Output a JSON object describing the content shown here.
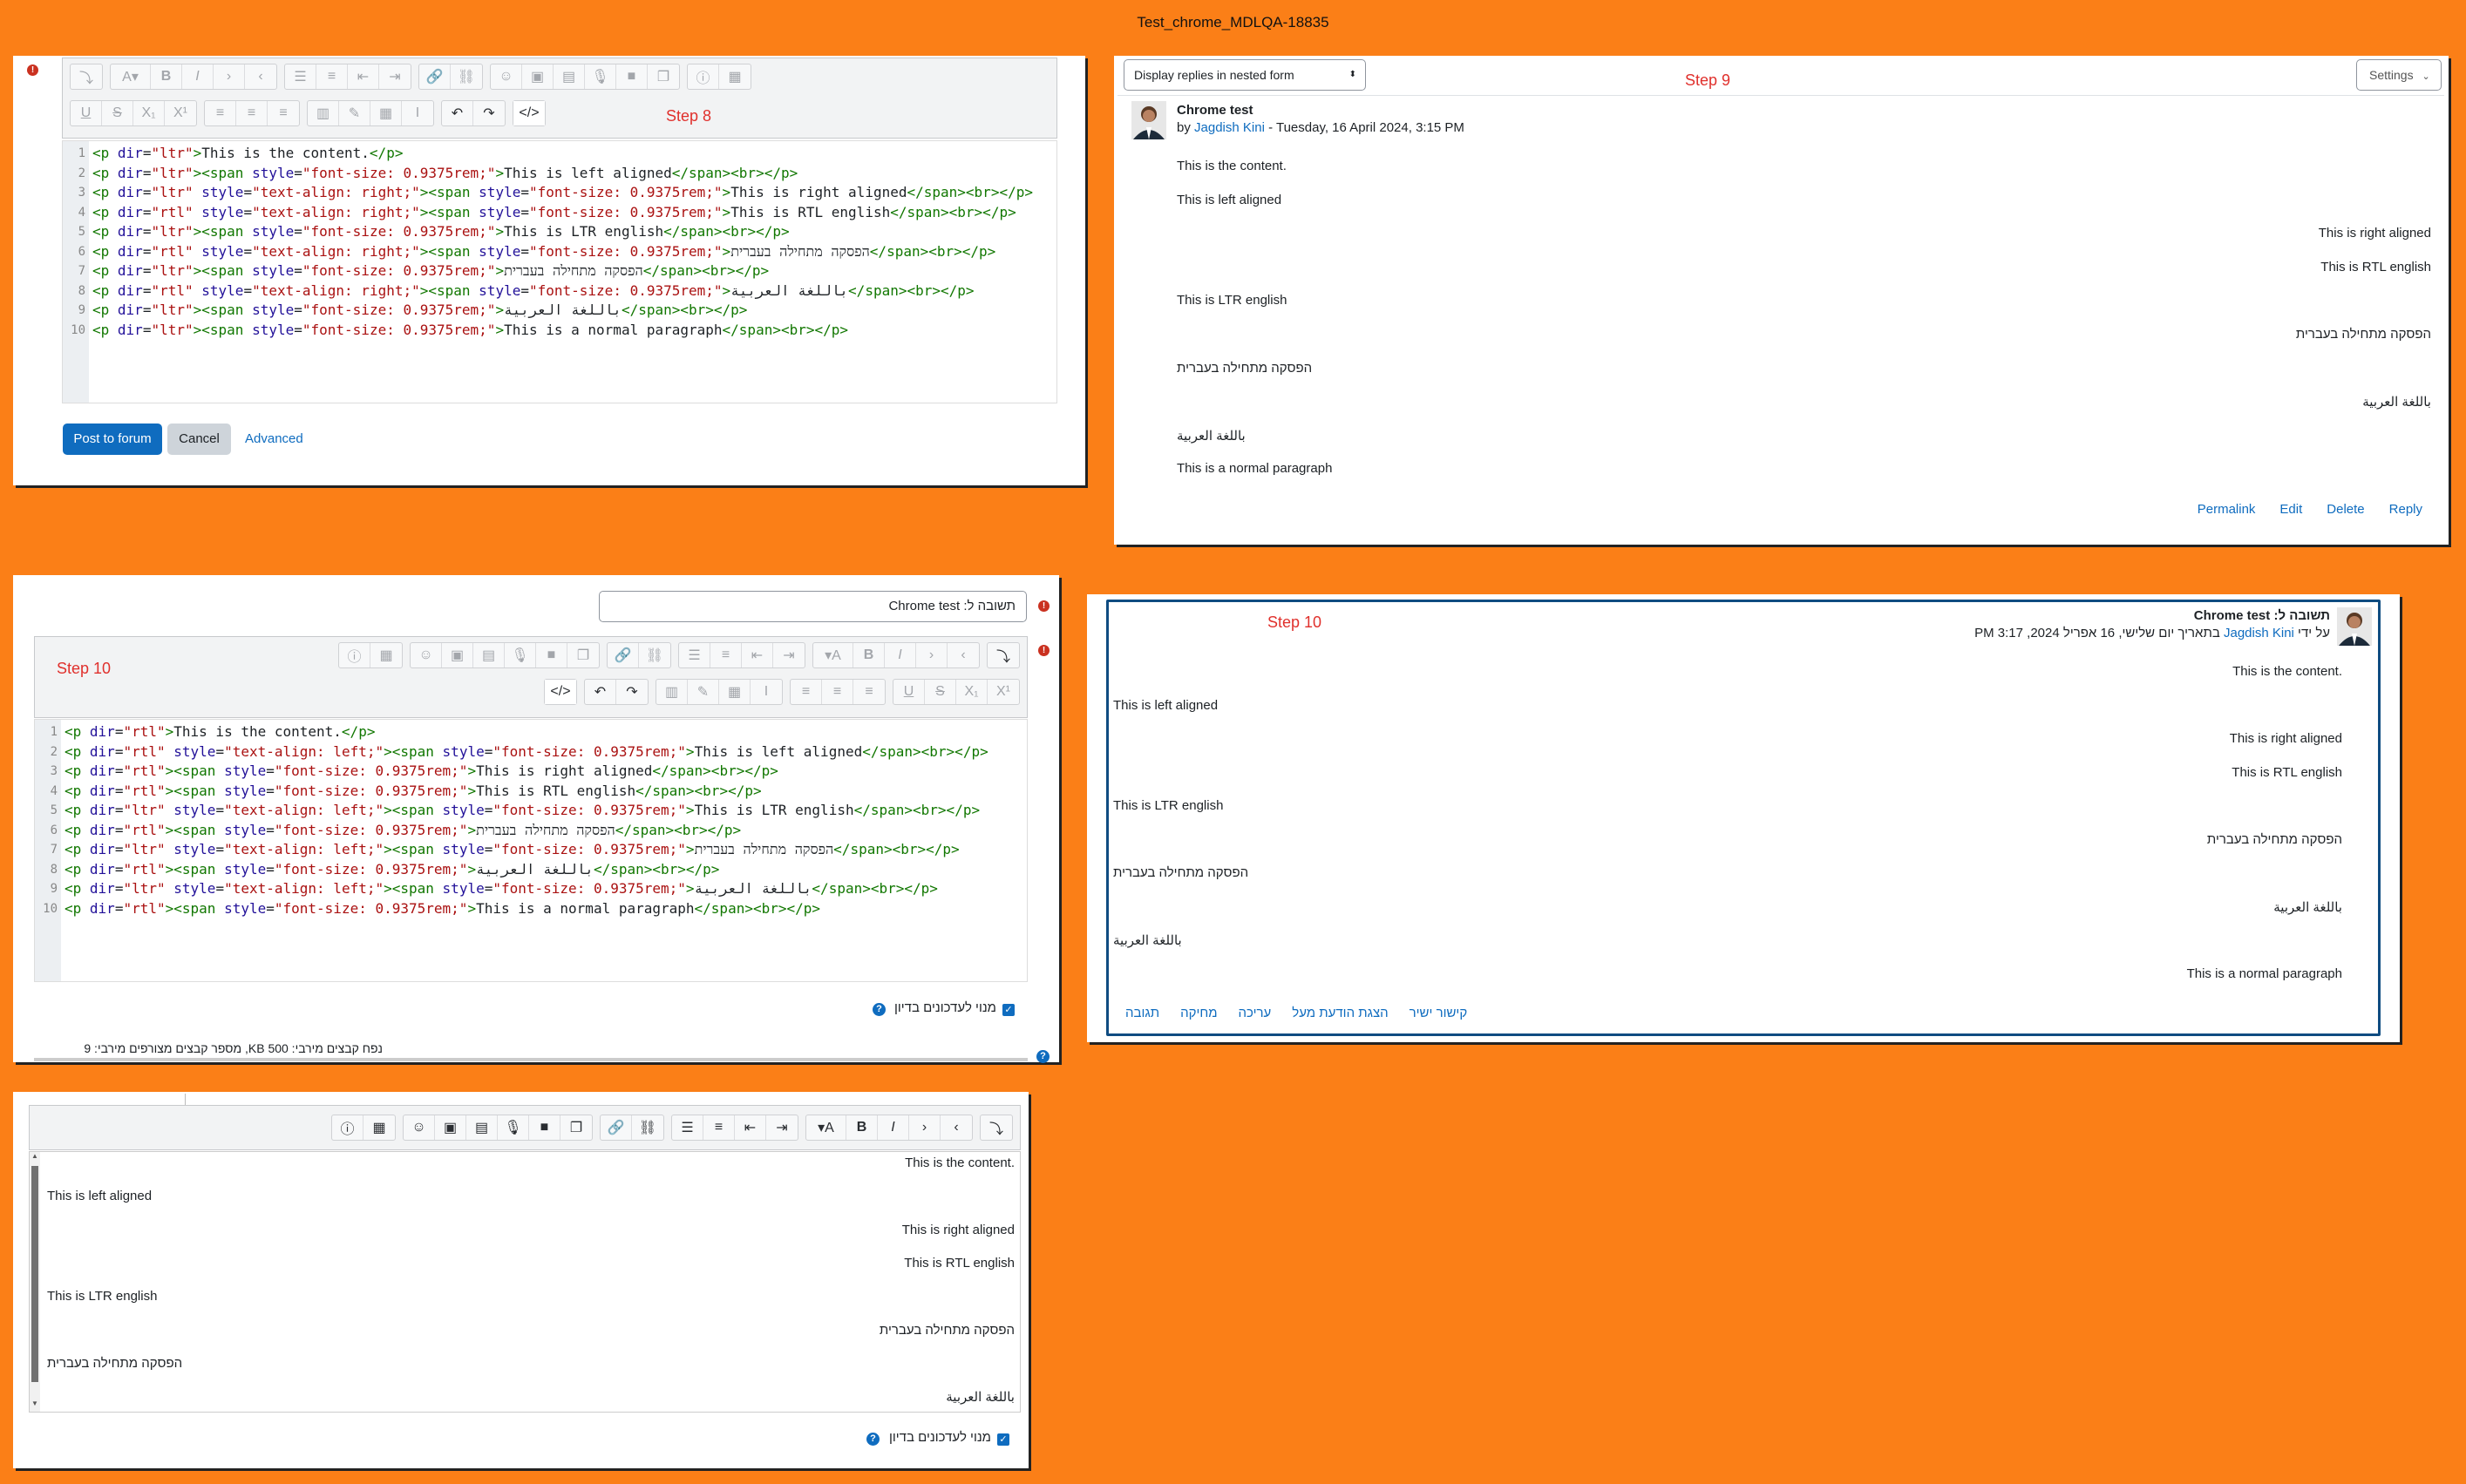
{
  "window_title": "Test_chrome_MDLQA-18835",
  "steps": {
    "s8": "Step 8",
    "s9": "Step 9",
    "s10a": "Step 10",
    "s10b": "Step 10"
  },
  "ltr_editor": {
    "lines": [
      {
        "n": "1",
        "html": "<span class='t'>&lt;p</span> <span class='a'>dir</span>=<span class='s'>\"ltr\"</span><span class='t'>&gt;</span>This is the content.<span class='t'>&lt;/p&gt;</span>"
      },
      {
        "n": "2",
        "html": "<span class='t'>&lt;p</span> <span class='a'>dir</span>=<span class='s'>\"ltr\"</span><span class='t'>&gt;&lt;span</span> <span class='a'>style</span>=<span class='s'>\"font-size: 0.9375rem;\"</span><span class='t'>&gt;</span>This is left aligned<span class='t'>&lt;/span&gt;&lt;br&gt;&lt;/p&gt;</span>"
      },
      {
        "n": "3",
        "html": "<span class='t'>&lt;p</span> <span class='a'>dir</span>=<span class='s'>\"ltr\"</span> <span class='a'>style</span>=<span class='s'>\"text-align: right;\"</span><span class='t'>&gt;&lt;span</span> <span class='a'>style</span>=<span class='s'>\"font-size: 0.9375rem;\"</span><span class='t'>&gt;</span>This is right aligned<span class='t'>&lt;/span&gt;&lt;br&gt;&lt;/p&gt;</span>"
      },
      {
        "n": "4",
        "html": "<span class='t'>&lt;p</span> <span class='a'>dir</span>=<span class='s'>\"rtl\"</span> <span class='a'>style</span>=<span class='s'>\"text-align: right;\"</span><span class='t'>&gt;&lt;span</span> <span class='a'>style</span>=<span class='s'>\"font-size: 0.9375rem;\"</span><span class='t'>&gt;</span>This is RTL english<span class='t'>&lt;/span&gt;&lt;br&gt;&lt;/p&gt;</span>"
      },
      {
        "n": "5",
        "html": "<span class='t'>&lt;p</span> <span class='a'>dir</span>=<span class='s'>\"ltr\"</span><span class='t'>&gt;&lt;span</span> <span class='a'>style</span>=<span class='s'>\"font-size: 0.9375rem;\"</span><span class='t'>&gt;</span>This is LTR english<span class='t'>&lt;/span&gt;&lt;br&gt;&lt;/p&gt;</span>"
      },
      {
        "n": "6",
        "html": "<span class='t'>&lt;p</span> <span class='a'>dir</span>=<span class='s'>\"rtl\"</span> <span class='a'>style</span>=<span class='s'>\"text-align: right;\"</span><span class='t'>&gt;&lt;span</span> <span class='a'>style</span>=<span class='s'>\"font-size: 0.9375rem;\"</span><span class='t'>&gt;</span>הפסקה מתחילה בעברית<span class='t'>&lt;/span&gt;&lt;br&gt;&lt;/p&gt;</span>"
      },
      {
        "n": "7",
        "html": "<span class='t'>&lt;p</span> <span class='a'>dir</span>=<span class='s'>\"ltr\"</span><span class='t'>&gt;&lt;span</span> <span class='a'>style</span>=<span class='s'>\"font-size: 0.9375rem;\"</span><span class='t'>&gt;</span>הפסקה מתחילה בעברית<span class='t'>&lt;/span&gt;&lt;br&gt;&lt;/p&gt;</span>"
      },
      {
        "n": "8",
        "html": "<span class='t'>&lt;p</span> <span class='a'>dir</span>=<span class='s'>\"rtl\"</span> <span class='a'>style</span>=<span class='s'>\"text-align: right;\"</span><span class='t'>&gt;&lt;span</span> <span class='a'>style</span>=<span class='s'>\"font-size: 0.9375rem;\"</span><span class='t'>&gt;</span>باللغة العربية<span class='t'>&lt;/span&gt;&lt;br&gt;&lt;/p&gt;</span>"
      },
      {
        "n": "9",
        "html": "<span class='t'>&lt;p</span> <span class='a'>dir</span>=<span class='s'>\"ltr\"</span><span class='t'>&gt;&lt;span</span> <span class='a'>style</span>=<span class='s'>\"font-size: 0.9375rem;\"</span><span class='t'>&gt;</span>باللغة العربية<span class='t'>&lt;/span&gt;&lt;br&gt;&lt;/p&gt;</span>"
      },
      {
        "n": "10",
        "html": "<span class='t'>&lt;p</span> <span class='a'>dir</span>=<span class='s'>\"ltr\"</span><span class='t'>&gt;&lt;span</span> <span class='a'>style</span>=<span class='s'>\"font-size: 0.9375rem;\"</span><span class='t'>&gt;</span>This is a normal paragraph<span class='t'>&lt;/span&gt;&lt;br&gt;&lt;/p&gt;</span>"
      }
    ],
    "post_label": "Post to forum",
    "cancel_label": "Cancel",
    "advanced_label": "Advanced"
  },
  "post_ltr": {
    "display_select": "Display replies in nested form",
    "settings_label": "Settings",
    "subject": "Chrome test",
    "by_prefix": "by",
    "author": "Jagdish Kini",
    "date": " - Tuesday, 16 April 2024, 3:15 PM",
    "paragraphs": [
      {
        "text": "This is the content.",
        "align": "left"
      },
      {
        "text": "This is left aligned",
        "align": "left"
      },
      {
        "text": "This is right aligned",
        "align": "right"
      },
      {
        "text": "This is RTL english",
        "align": "right"
      },
      {
        "text": "This is LTR english",
        "align": "left"
      },
      {
        "text": "הפסקה מתחילה בעברית",
        "align": "right"
      },
      {
        "text": "הפסקה מתחילה בעברית",
        "align": "left"
      },
      {
        "text": "باللغة العربية",
        "align": "right"
      },
      {
        "text": "باللغة العربية",
        "align": "left"
      },
      {
        "text": "This is a normal paragraph",
        "align": "left"
      }
    ],
    "actions": [
      "Permalink",
      "Edit",
      "Delete",
      "Reply"
    ]
  },
  "rtl_editor": {
    "subject_value": "תשובה ל: Chrome test",
    "lines": [
      {
        "n": "1",
        "html": "<span class='t'>&lt;p</span> <span class='a'>dir</span>=<span class='s'>\"rtl\"</span><span class='t'>&gt;</span>This is the content.<span class='t'>&lt;/p&gt;</span>"
      },
      {
        "n": "2",
        "html": "<span class='t'>&lt;p</span> <span class='a'>dir</span>=<span class='s'>\"rtl\"</span> <span class='a'>style</span>=<span class='s'>\"text-align: left;\"</span><span class='t'>&gt;&lt;span</span> <span class='a'>style</span>=<span class='s'>\"font-size: 0.9375rem;\"</span><span class='t'>&gt;</span>This is left aligned<span class='t'>&lt;/span&gt;&lt;br&gt;&lt;/p&gt;</span>"
      },
      {
        "n": "3",
        "html": "<span class='t'>&lt;p</span> <span class='a'>dir</span>=<span class='s'>\"rtl\"</span><span class='t'>&gt;&lt;span</span> <span class='a'>style</span>=<span class='s'>\"font-size: 0.9375rem;\"</span><span class='t'>&gt;</span>This is right aligned<span class='t'>&lt;/span&gt;&lt;br&gt;&lt;/p&gt;</span>"
      },
      {
        "n": "4",
        "html": "<span class='t'>&lt;p</span> <span class='a'>dir</span>=<span class='s'>\"rtl\"</span><span class='t'>&gt;&lt;span</span> <span class='a'>style</span>=<span class='s'>\"font-size: 0.9375rem;\"</span><span class='t'>&gt;</span>This is RTL english<span class='t'>&lt;/span&gt;&lt;br&gt;&lt;/p&gt;</span>"
      },
      {
        "n": "5",
        "html": "<span class='t'>&lt;p</span> <span class='a'>dir</span>=<span class='s'>\"ltr\"</span> <span class='a'>style</span>=<span class='s'>\"text-align: left;\"</span><span class='t'>&gt;&lt;span</span> <span class='a'>style</span>=<span class='s'>\"font-size: 0.9375rem;\"</span><span class='t'>&gt;</span>This is LTR english<span class='t'>&lt;/span&gt;&lt;br&gt;&lt;/p&gt;</span>"
      },
      {
        "n": "6",
        "html": "<span class='t'>&lt;p</span> <span class='a'>dir</span>=<span class='s'>\"rtl\"</span><span class='t'>&gt;&lt;span</span> <span class='a'>style</span>=<span class='s'>\"font-size: 0.9375rem;\"</span><span class='t'>&gt;</span>הפסקה מתחילה בעברית<span class='t'>&lt;/span&gt;&lt;br&gt;&lt;/p&gt;</span>"
      },
      {
        "n": "7",
        "html": "<span class='t'>&lt;p</span> <span class='a'>dir</span>=<span class='s'>\"ltr\"</span> <span class='a'>style</span>=<span class='s'>\"text-align: left;\"</span><span class='t'>&gt;&lt;span</span> <span class='a'>style</span>=<span class='s'>\"font-size: 0.9375rem;\"</span><span class='t'>&gt;</span>הפסקה מתחילה בעברית<span class='t'>&lt;/span&gt;&lt;br&gt;&lt;/p&gt;</span>"
      },
      {
        "n": "8",
        "html": "<span class='t'>&lt;p</span> <span class='a'>dir</span>=<span class='s'>\"rtl\"</span><span class='t'>&gt;&lt;span</span> <span class='a'>style</span>=<span class='s'>\"font-size: 0.9375rem;\"</span><span class='t'>&gt;</span>باللغة العربية<span class='t'>&lt;/span&gt;&lt;br&gt;&lt;/p&gt;</span>"
      },
      {
        "n": "9",
        "html": "<span class='t'>&lt;p</span> <span class='a'>dir</span>=<span class='s'>\"ltr\"</span> <span class='a'>style</span>=<span class='s'>\"text-align: left;\"</span><span class='t'>&gt;&lt;span</span> <span class='a'>style</span>=<span class='s'>\"font-size: 0.9375rem;\"</span><span class='t'>&gt;</span>باللغة العربية<span class='t'>&lt;/span&gt;&lt;br&gt;&lt;/p&gt;</span>"
      },
      {
        "n": "10",
        "html": "<span class='t'>&lt;p</span> <span class='a'>dir</span>=<span class='s'>\"rtl\"</span><span class='t'>&gt;&lt;span</span> <span class='a'>style</span>=<span class='s'>\"font-size: 0.9375rem;\"</span><span class='t'>&gt;</span>This is a normal paragraph<span class='t'>&lt;/span&gt;&lt;br&gt;&lt;/p&gt;</span>"
      }
    ],
    "subscribe_label": "מנוי לעדכונים בדיון",
    "files_info": "נפח קבצים מירבי: 500 KB, מספר קבצים מצורפים מירבי: 9"
  },
  "post_rtl": {
    "subject": "תשובה ל: Chrome test",
    "by_prefix": "על ידי ",
    "author": "Jagdish Kini",
    "date": " בתאריך יום שלישי, 16 אפריל 2024, 3:17 PM",
    "paragraphs": [
      {
        "text": "This is the content.",
        "align": "right"
      },
      {
        "text": "This is left aligned",
        "align": "left"
      },
      {
        "text": "This is right aligned",
        "align": "right"
      },
      {
        "text": "This is RTL english",
        "align": "right"
      },
      {
        "text": "This is LTR english",
        "align": "left"
      },
      {
        "text": "הפסקה מתחילה בעברית",
        "align": "right"
      },
      {
        "text": "הפסקה מתחילה בעברית",
        "align": "left"
      },
      {
        "text": "باللغة العربية",
        "align": "right"
      },
      {
        "text": "باللغة العربية",
        "align": "left"
      },
      {
        "text": "This is a normal paragraph",
        "align": "right"
      }
    ],
    "actions": [
      "קישור ישיר",
      "הצגת הודעת מעל",
      "עריכה",
      "מחיקה",
      "תגובה"
    ]
  },
  "rtl_wysiwyg": {
    "paragraphs": [
      {
        "text": "This is the content.",
        "align": "right"
      },
      {
        "text": "This is left aligned",
        "align": "left"
      },
      {
        "text": "This is right aligned",
        "align": "right"
      },
      {
        "text": "This is RTL english",
        "align": "right"
      },
      {
        "text": "This is LTR english",
        "align": "left"
      },
      {
        "text": "הפסקה מתחילה בעברית",
        "align": "right"
      },
      {
        "text": "הפסקה מתחילה בעברית",
        "align": "left"
      },
      {
        "text": "باللغة العربية",
        "align": "right"
      }
    ],
    "subscribe_label": "מנוי לעדכונים בדיון"
  }
}
